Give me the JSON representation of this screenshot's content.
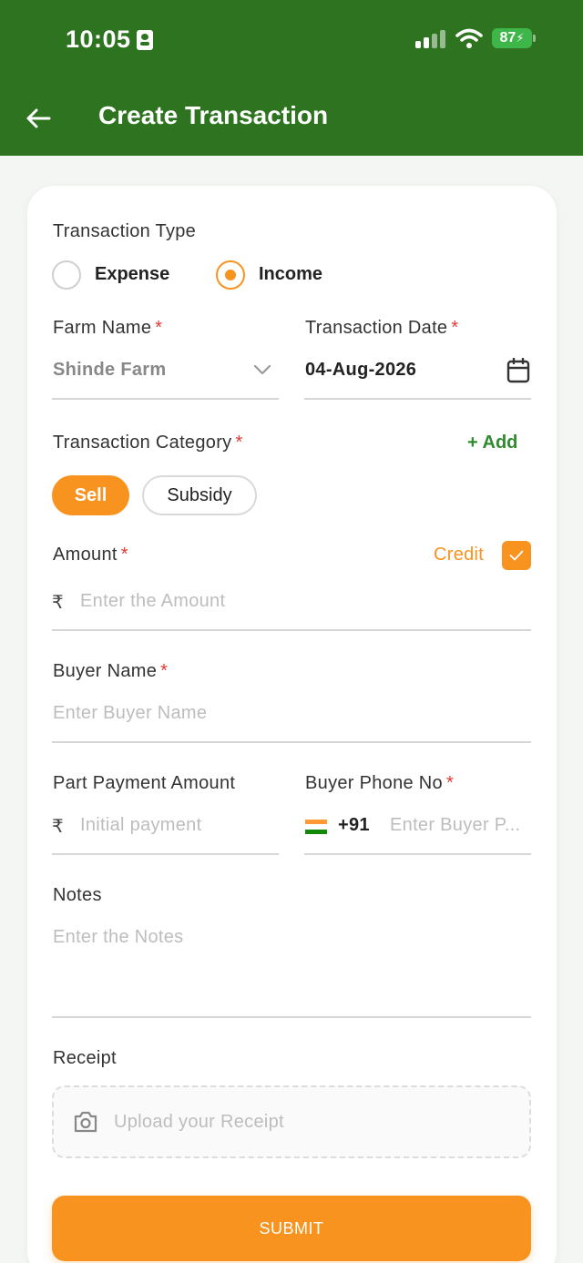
{
  "status_bar": {
    "time": "10:05",
    "battery": "87"
  },
  "header": {
    "title": "Create Transaction"
  },
  "form": {
    "transaction_type": {
      "label": "Transaction Type",
      "options": [
        "Expense",
        "Income"
      ],
      "selected": "Income"
    },
    "farm_name": {
      "label": "Farm Name",
      "value": "Shinde Farm"
    },
    "transaction_date": {
      "label": "Transaction Date",
      "value": "04-Aug-2026"
    },
    "transaction_category": {
      "label": "Transaction Category",
      "add_label": "+ Add",
      "chips": [
        "Sell",
        "Subsidy"
      ],
      "selected": "Sell"
    },
    "amount": {
      "label": "Amount",
      "currency": "₹",
      "placeholder": "Enter the Amount",
      "credit_label": "Credit",
      "credit_checked": true
    },
    "buyer_name": {
      "label": "Buyer Name",
      "placeholder": "Enter Buyer Name"
    },
    "part_payment": {
      "label": "Part Payment Amount",
      "currency": "₹",
      "placeholder": "Initial payment"
    },
    "buyer_phone": {
      "label": "Buyer Phone No",
      "country_code": "+91",
      "placeholder": "Enter Buyer P..."
    },
    "notes": {
      "label": "Notes",
      "placeholder": "Enter the Notes"
    },
    "receipt": {
      "label": "Receipt",
      "placeholder": "Upload your Receipt"
    },
    "required_mark": "*"
  },
  "submit_label": "SUBMIT",
  "colors": {
    "header": "#2e7420",
    "accent": "#f7931e",
    "add": "#2e8b2e",
    "required": "#e53935"
  }
}
